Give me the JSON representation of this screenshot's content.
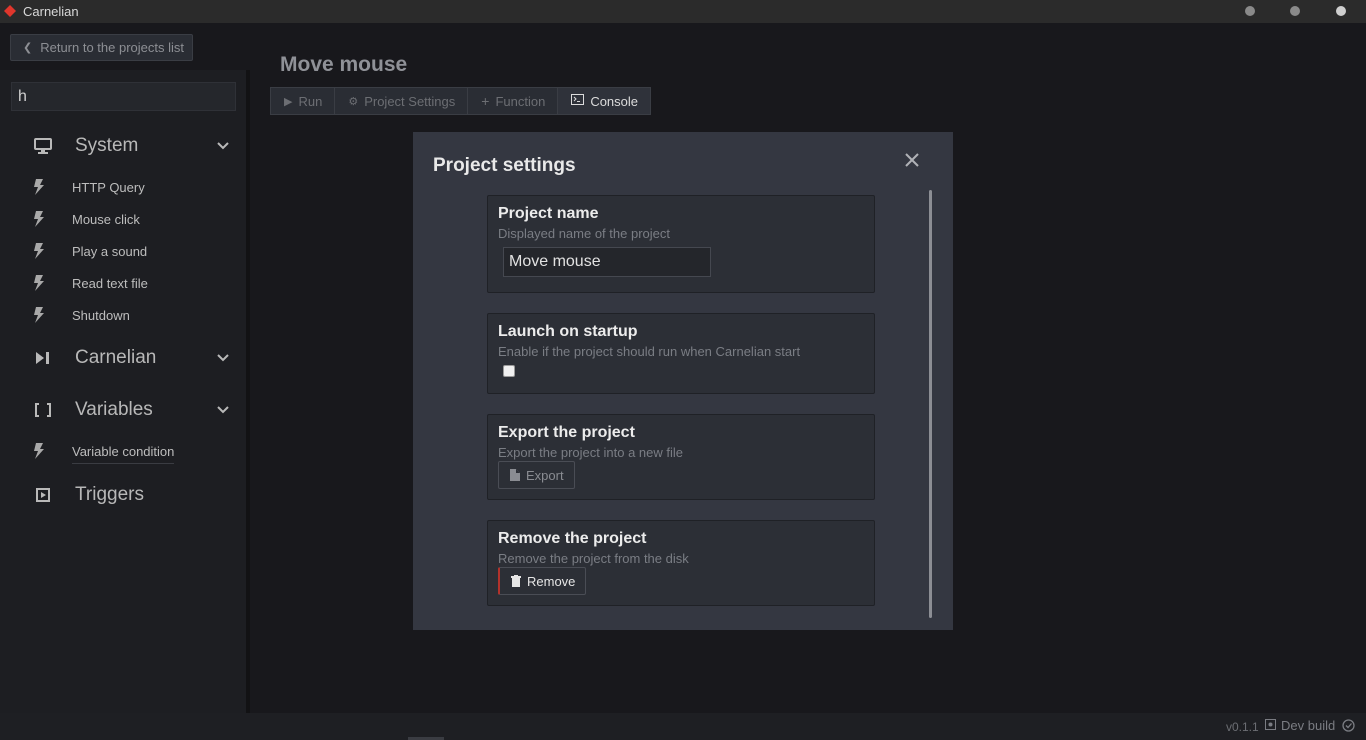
{
  "app": {
    "title": "Carnelian",
    "brand_color": "#e0362c"
  },
  "back_button": {
    "label": "Return to the projects list",
    "icon": "chevron-left-icon"
  },
  "search": {
    "value": "h"
  },
  "sidebar": {
    "categories": [
      {
        "label": "System",
        "icon": "monitor-icon",
        "expanded": true,
        "items": [
          {
            "label": "HTTP Query",
            "icon": "bolt-icon"
          },
          {
            "label": "Mouse click",
            "icon": "bolt-icon"
          },
          {
            "label": "Play a sound",
            "icon": "bolt-icon"
          },
          {
            "label": "Read text file",
            "icon": "bolt-icon"
          },
          {
            "label": "Shutdown",
            "icon": "bolt-icon"
          }
        ]
      },
      {
        "label": "Carnelian",
        "icon": "carnelian-icon",
        "expanded": false,
        "items": []
      },
      {
        "label": "Variables",
        "icon": "brackets-icon",
        "expanded": true,
        "items": [
          {
            "label": "Variable condition",
            "icon": "bolt-icon"
          }
        ]
      },
      {
        "label": "Triggers",
        "icon": "play-square-icon",
        "expanded": false,
        "items": []
      }
    ]
  },
  "main": {
    "title": "Move mouse",
    "toolbar": {
      "run": "Run",
      "project_settings": "Project Settings",
      "function": "Function",
      "console": "Console"
    }
  },
  "modal": {
    "title": "Project settings",
    "cards": {
      "name": {
        "title": "Project name",
        "description": "Displayed name of the project",
        "value": "Move mouse"
      },
      "startup": {
        "title": "Launch on startup",
        "description": "Enable if the project should run when Carnelian start",
        "checked": false
      },
      "export": {
        "title": "Export the project",
        "description": "Export the project into a new file",
        "button": "Export"
      },
      "remove": {
        "title": "Remove the project",
        "description": "Remove the project from the disk",
        "button": "Remove",
        "accent": "#b3322b"
      }
    }
  },
  "footer": {
    "version": "v0.1.1",
    "build": "Dev build"
  }
}
